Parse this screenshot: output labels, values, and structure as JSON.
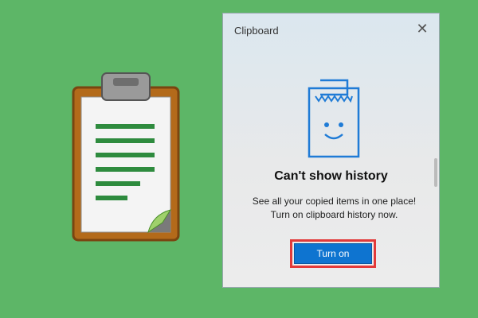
{
  "panel": {
    "title": "Clipboard",
    "heading": "Can't show history",
    "description": "See all your copied items in one place! Turn on clipboard history now.",
    "turn_on_label": "Turn on",
    "close_glyph": "✕"
  },
  "icons": {
    "illustration": "clipboard-icon",
    "history": "smiling-receipt-icon",
    "close": "close-icon"
  },
  "colors": {
    "background": "#5db667",
    "accent": "#0e74d0",
    "highlight": "#e23a3a"
  }
}
